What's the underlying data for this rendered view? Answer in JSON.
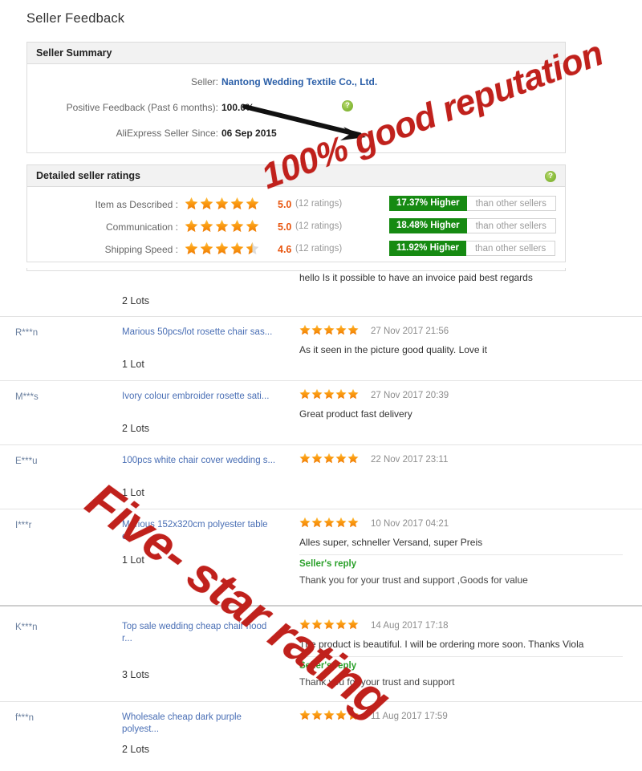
{
  "page": {
    "title": "Seller Feedback"
  },
  "seller_summary": {
    "heading": "Seller Summary",
    "rows": [
      {
        "label": "Seller:",
        "value": "Nantong Wedding Textile Co., Ltd.",
        "is_link": true
      },
      {
        "label": "Positive Feedback (Past 6 months):",
        "value": "100.0%",
        "is_link": false,
        "help": "?"
      },
      {
        "label": "AliExpress Seller Since:",
        "value": "06 Sep 2015",
        "is_link": false
      }
    ]
  },
  "detailed_ratings": {
    "heading": "Detailed seller ratings",
    "help": "?",
    "compare_suffix": "than other sellers",
    "rows": [
      {
        "label": "Item as Described :",
        "stars": 5,
        "score": "5.0",
        "count": "(12 ratings)",
        "compare_value": "17.37% Higher"
      },
      {
        "label": "Communication :",
        "stars": 5,
        "score": "5.0",
        "count": "(12 ratings)",
        "compare_value": "18.48% Higher"
      },
      {
        "label": "Shipping Speed :",
        "stars": 4.5,
        "score": "4.6",
        "count": "(12 ratings)",
        "compare_value": "11.92% Higher"
      }
    ]
  },
  "feedback": {
    "reply_title": "Seller's reply",
    "rows": [
      {
        "user": "",
        "product": "",
        "qty": "2 Lots",
        "stars": 0,
        "date": "",
        "comment": "hello Is it possible to have an invoice paid best regards",
        "reply": null
      },
      {
        "user": "R***n",
        "product": "Marious 50pcs/lot rosette chair sas...",
        "qty": "1 Lot",
        "stars": 5,
        "date": "27 Nov 2017 21:56",
        "comment": "As it seen in the picture good quality. Love it",
        "reply": null
      },
      {
        "user": "M***s",
        "product": "Ivory colour embroider rosette sati...",
        "qty": "2 Lots",
        "stars": 5,
        "date": "27 Nov 2017 20:39",
        "comment": "Great product fast delivery",
        "reply": null
      },
      {
        "user": "E***u",
        "product": "100pcs white chair cover wedding s...",
        "qty": "1 Lot",
        "stars": 5,
        "date": "22 Nov 2017 23:11",
        "comment": "",
        "reply": null
      },
      {
        "user": "I***r",
        "product": "Marious 152x320cm polyester table c...",
        "qty": "1 Lot",
        "stars": 5,
        "date": "10 Nov 2017 04:21",
        "comment": "Alles super, schneller Versand, super Preis",
        "reply": "Thank you for your trust and support ,Goods for value"
      },
      {
        "user": "K***n",
        "product": "Top sale wedding cheap chair hood r...",
        "qty": "3 Lots",
        "stars": 5,
        "date": "14 Aug 2017 17:18",
        "comment": "The product is beautiful. I will be ordering more soon. Thanks Viola",
        "reply": "Thank you for your trust and support"
      },
      {
        "user": "f***n",
        "product": "Wholesale cheap dark purple polyest...",
        "qty": "2 Lots",
        "stars": 5,
        "date": "11 Aug 2017 17:59",
        "comment": "",
        "reply": null
      }
    ]
  },
  "annotations": {
    "watermark_reputation": "100% good reputation",
    "watermark_fivestar": "Five- star rating",
    "arrow": "arrow-pointing-to-positive-feedback"
  },
  "colors": {
    "accent_red": "#c0211c",
    "star_orange": "#f79400",
    "badge_green": "#168a12",
    "link_blue": "#4a6fb5",
    "reply_green": "#2ca12c",
    "score_orange": "#e8540d"
  }
}
